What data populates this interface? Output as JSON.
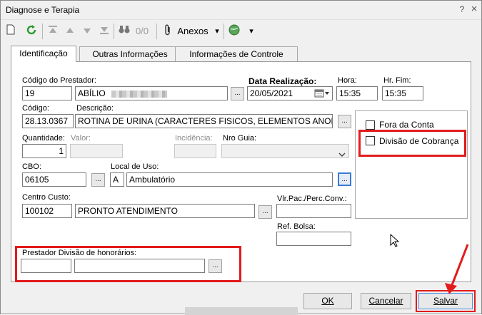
{
  "window": {
    "title": "Diagnose e Terapia",
    "help_glyph": "?",
    "close_glyph": "×"
  },
  "toolbar": {
    "counter": "0/0",
    "attachments_label": "Anexos",
    "dropdown_glyph": "▾"
  },
  "tabs": [
    {
      "label": "Identificação"
    },
    {
      "label": "Outras Informações"
    },
    {
      "label": "Informações de Controle"
    }
  ],
  "form": {
    "codigo_prestador": {
      "label": "Código do Prestador:",
      "code": "19",
      "name": "ABÍLIO"
    },
    "data_realizacao": {
      "label": "Data Realização:",
      "value": "20/05/2021"
    },
    "hora": {
      "label": "Hora:",
      "value": "15:35"
    },
    "hr_fim": {
      "label": "Hr. Fim:",
      "value": "15:35"
    },
    "codigo": {
      "label": "Código:",
      "value": "28.13.0367"
    },
    "descricao": {
      "label": "Descrição:",
      "value": "ROTINA DE URINA (CARACTERES FISICOS, ELEMENTOS ANORMAIS"
    },
    "quantidade": {
      "label": "Quantidade:",
      "value": "1"
    },
    "valor": {
      "label": "Valor:",
      "value": ""
    },
    "incidencia": {
      "label": "Incidência:",
      "value": ""
    },
    "nro_guia": {
      "label": "Nro Guia:",
      "value": ""
    },
    "cbo": {
      "label": "CBO:",
      "value": "06105"
    },
    "local_uso": {
      "label": "Local de Uso:",
      "code": "A",
      "name": "Ambulatório"
    },
    "centro_custo": {
      "label": "Centro Custo:",
      "code": "100102",
      "name": "PRONTO ATENDIMENTO"
    },
    "vlr_pac": {
      "label": "Vlr.Pac./Perc.Conv.:",
      "value": ""
    },
    "ref_bolsa": {
      "label": "Ref. Bolsa:",
      "value": ""
    },
    "prestador_divisao": {
      "label": "Prestador Divisão de honorários:",
      "code": "",
      "name": ""
    },
    "fora_da_conta": {
      "label": "Fora da Conta",
      "checked": false
    },
    "divisao_cobranca": {
      "label": "Divisão de Cobrança",
      "checked": false
    },
    "ellipsis": "..."
  },
  "buttons": {
    "ok": "OK",
    "cancel": "Cancelar",
    "save": "Salvar"
  },
  "colors": {
    "annotation_red": "#e21b1b",
    "focus_blue": "#3a7bd5"
  }
}
